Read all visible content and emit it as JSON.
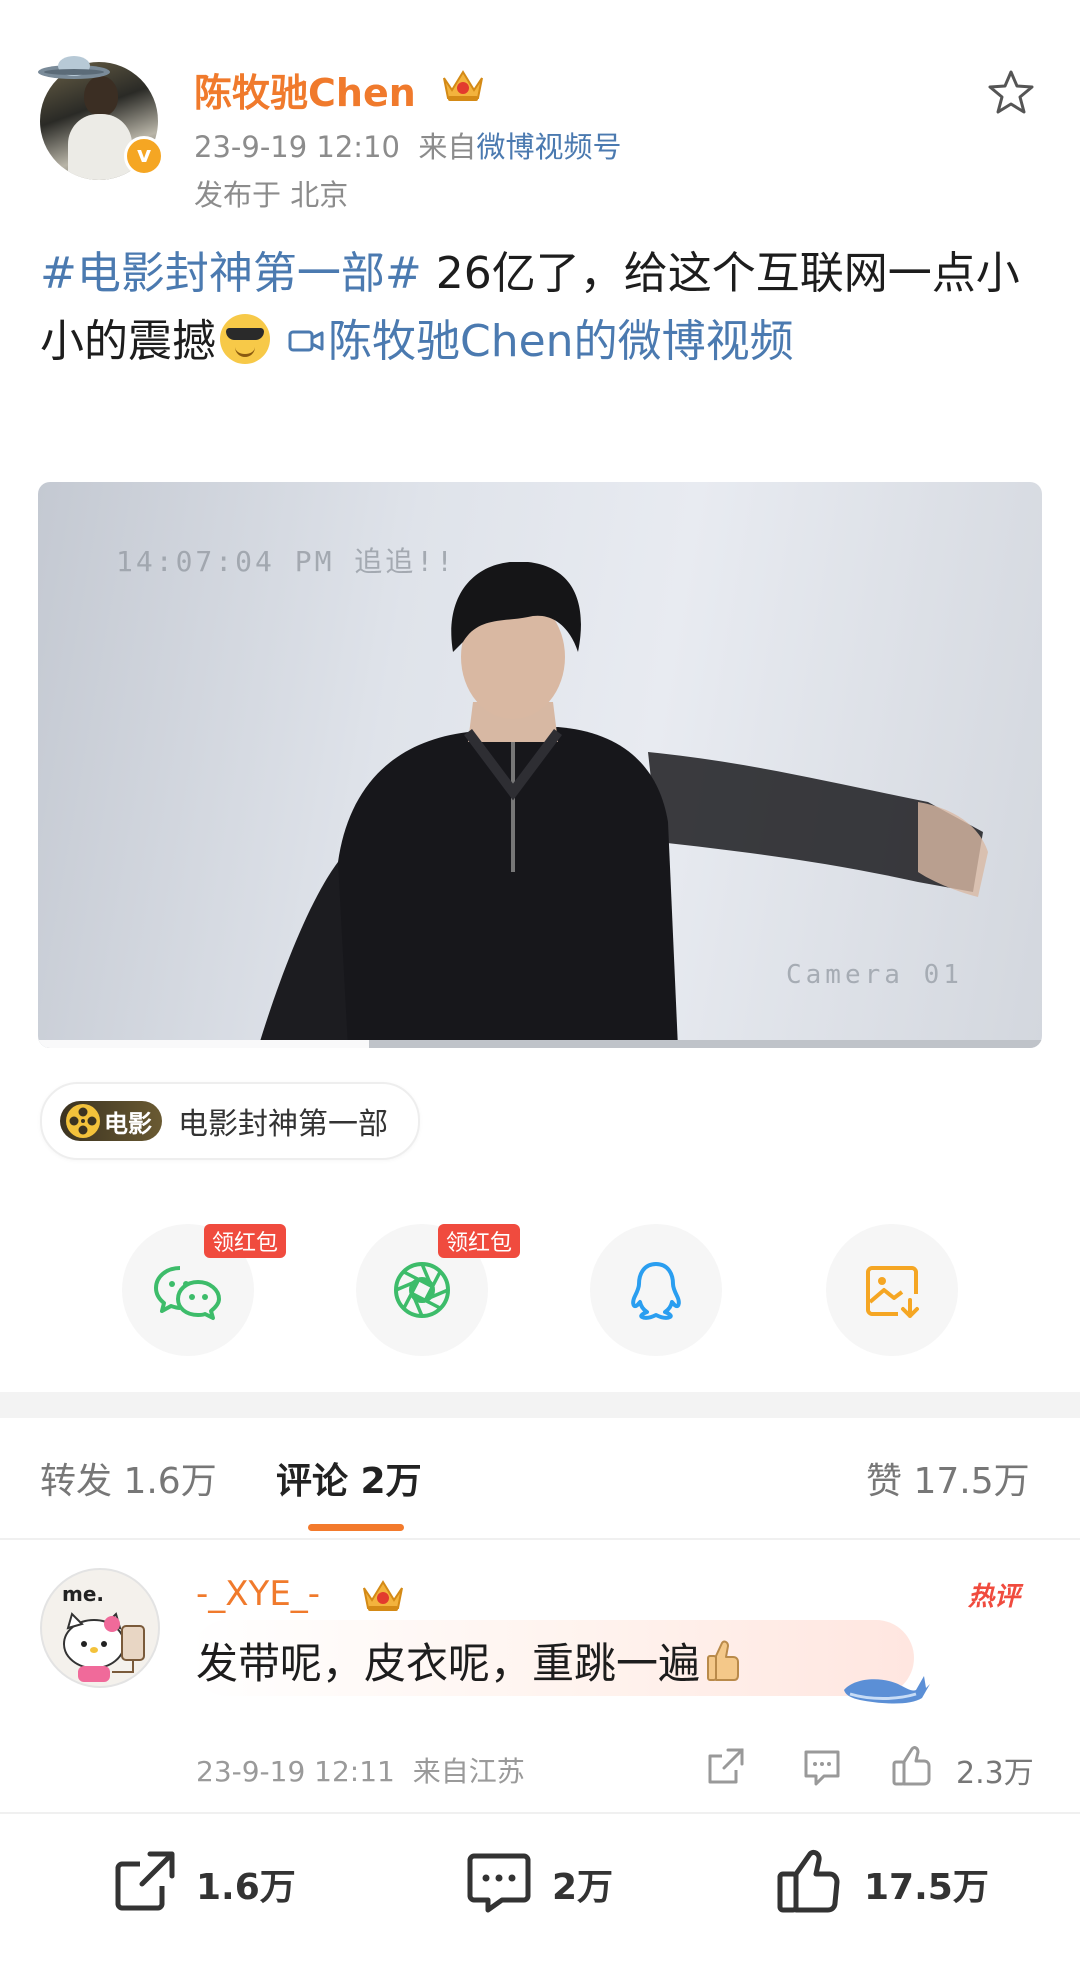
{
  "post": {
    "author": {
      "name": "陈牧驰Chen",
      "time": "23-9-19 12:10",
      "source_prefix": "来自",
      "source_link": "微博视频号",
      "location": "发布于 北京"
    },
    "text": {
      "hashtag": "#电影封神第一部#",
      "body": " 26亿了，给这个互联网一点小小的震撼",
      "video_link": "陈牧驰Chen的微博视频"
    },
    "video": {
      "osd_time": "14:07:04 PM 追追!!",
      "osd_camera": "Camera 01",
      "progress": 0.33
    },
    "topic": {
      "badge": "电影",
      "label": "电影封神第一部"
    }
  },
  "share": {
    "red_packet_label": "领红包",
    "buttons": [
      {
        "name": "wechat",
        "badge": "领红包",
        "color": "#3dbc6a"
      },
      {
        "name": "moments",
        "badge": "领红包",
        "color": "#3dbc6a"
      },
      {
        "name": "qq",
        "badge": "",
        "color": "#2a9ef0"
      },
      {
        "name": "save-image",
        "badge": "",
        "color": "#f5a623"
      }
    ]
  },
  "tabs": {
    "repost": "转发 1.6万",
    "comments": "评论 2万",
    "likes": "赞 17.5万"
  },
  "comment": {
    "avatar_text": "me.",
    "user": "-_XYE_-",
    "hot_badge": "热评",
    "text": "发带呢，皮衣呢，重跳一遍",
    "time": "23-9-19 12:11",
    "source": "来自江苏",
    "like_count": "2.3万"
  },
  "bottom_bar": {
    "repost_count": "1.6万",
    "comment_count": "2万",
    "like_count": "17.5万"
  },
  "colors": {
    "accent_orange": "#f07a2c",
    "link_blue": "#4b7ab0",
    "red_tag": "#f04b3e"
  }
}
